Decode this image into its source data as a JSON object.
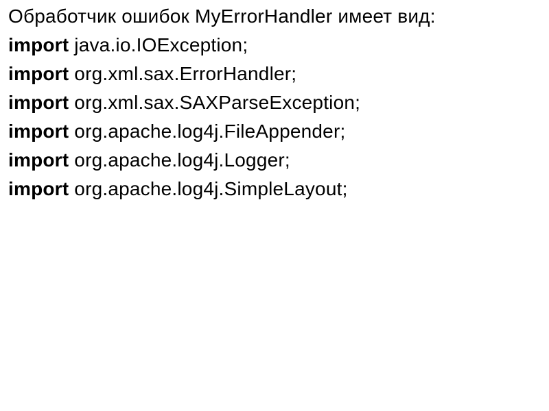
{
  "heading": "Обработчик ошибок MyErrorHandler имеет вид:",
  "lines": [
    {
      "keyword": "import",
      "rest": " java.io.IOException;"
    },
    {
      "keyword": "import",
      "rest": " org.xml.sax.ErrorHandler;"
    },
    {
      "keyword": "import",
      "rest": " org.xml.sax.SAXParseException;"
    },
    {
      "keyword": "import",
      "rest": " org.apache.log4j.FileAppender;"
    },
    {
      "keyword": "import",
      "rest": " org.apache.log4j.Logger;"
    },
    {
      "keyword": "import",
      "rest": " org.apache.log4j.SimpleLayout;"
    }
  ]
}
